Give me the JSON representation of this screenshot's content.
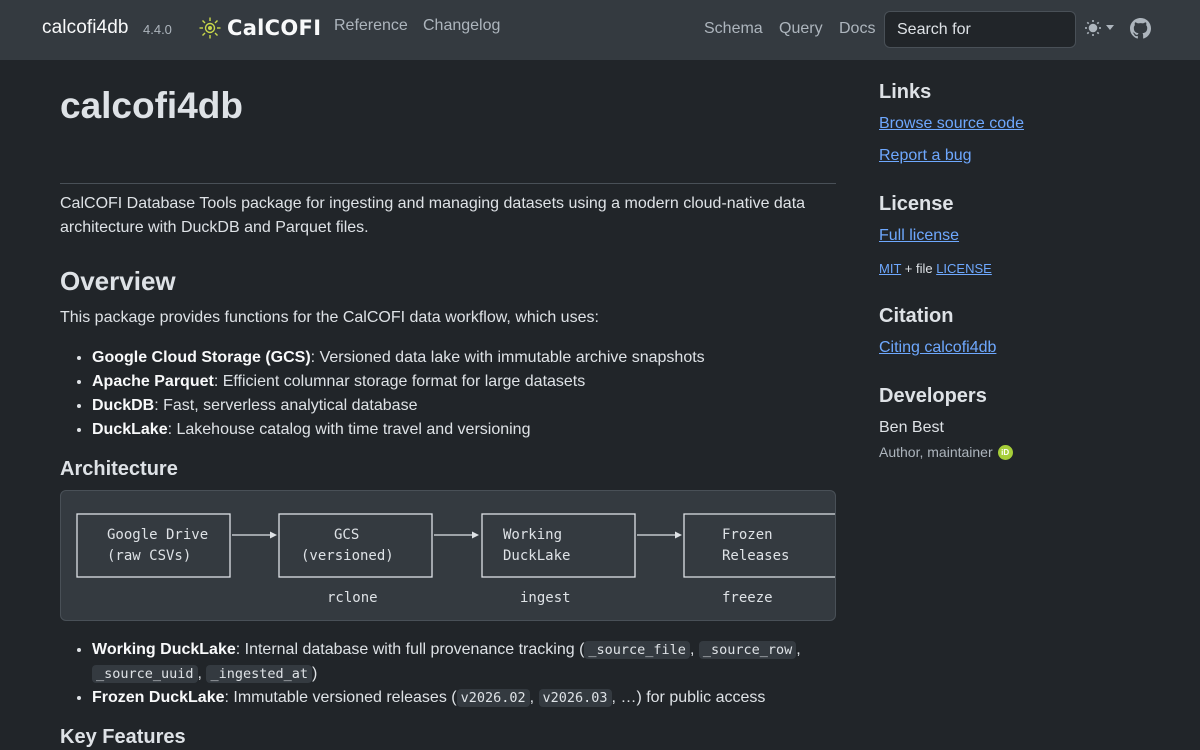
{
  "navbar": {
    "brand": "calcofi4db",
    "version": "4.4.0",
    "logo_text": "CalCOFI",
    "left_links": [
      "Reference",
      "Changelog"
    ],
    "right_links": [
      "Schema",
      "Query",
      "Docs"
    ],
    "search_placeholder": "Search for",
    "icons": [
      "theme-toggle-icon",
      "github-icon"
    ]
  },
  "main": {
    "title": "calcofi4db",
    "intro": "CalCOFI Database Tools package for ingesting and managing datasets using a modern cloud-native data architecture with DuckDB and Parquet files.",
    "overview": {
      "heading": "Overview",
      "lead": "This package provides functions for the CalCOFI data workflow, which uses:",
      "items": [
        {
          "term": "Google Cloud Storage (GCS)",
          "desc": ": Versioned data lake with immutable archive snapshots"
        },
        {
          "term": "Apache Parquet",
          "desc": ": Efficient columnar storage format for large datasets"
        },
        {
          "term": "DuckDB",
          "desc": ": Fast, serverless analytical database"
        },
        {
          "term": "DuckLake",
          "desc": ": Lakehouse catalog with time travel and versioning"
        }
      ]
    },
    "architecture": {
      "heading": "Architecture",
      "boxes": [
        {
          "line1": "Google Drive",
          "line2": "(raw CSVs)"
        },
        {
          "line1": "GCS",
          "line2": "(versioned)"
        },
        {
          "line1": "Working",
          "line2": "DuckLake"
        },
        {
          "line1": "Frozen",
          "line2": "Releases"
        }
      ],
      "steps": [
        "rclone",
        "ingest",
        "freeze"
      ],
      "items": [
        {
          "term": "Working DuckLake",
          "desc_a": ": Internal database with full provenance tracking (",
          "codes": [
            "_source_file",
            "_source_row",
            "_source_uuid",
            "_ingested_at"
          ],
          "sep": ", ",
          "desc_b": ")"
        },
        {
          "term": "Frozen DuckLake",
          "desc_a": ": Immutable versioned releases (",
          "codes": [
            "v2026.02",
            "v2026.03"
          ],
          "desc_b": ", …) for public access"
        }
      ]
    },
    "key_features_heading": "Key Features"
  },
  "sidebar": {
    "links_heading": "Links",
    "links": [
      "Browse source code",
      "Report a bug"
    ],
    "license_heading": "License",
    "license_link": "Full license",
    "license_mit": "MIT",
    "license_file_text": " + file ",
    "license_file": "LICENSE",
    "citation_heading": "Citation",
    "citation_link": "Citing calcofi4db",
    "developers_heading": "Developers",
    "developer_name": "Ben Best",
    "developer_role": "Author, maintainer",
    "orcid_label": "iD"
  },
  "colors": {
    "background": "#212529",
    "navbar": "#343a40",
    "link": "#6ea8fe",
    "orcid": "#a6ce39"
  }
}
